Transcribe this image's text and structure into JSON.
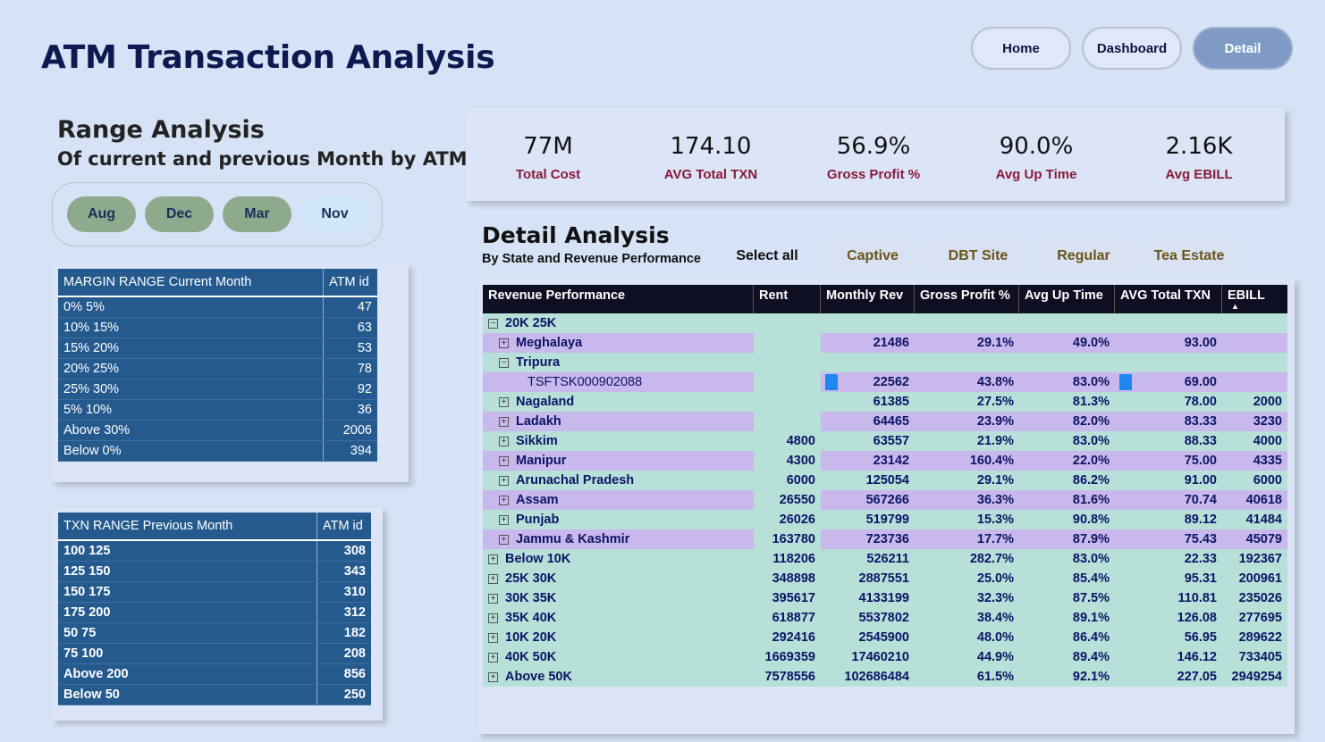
{
  "app_title": "ATM Transaction Analysis",
  "nav": {
    "home": "Home",
    "dashboard": "Dashboard",
    "detail": "Detail"
  },
  "range": {
    "title": "Range Analysis",
    "subtitle": "Of current and previous Month by ATM ID"
  },
  "months": [
    "Aug",
    "Dec",
    "Mar",
    "Nov"
  ],
  "margin_table": {
    "header": [
      "MARGIN RANGE Current Month",
      "ATM id"
    ],
    "rows": [
      [
        "0% 5%",
        "47"
      ],
      [
        "10% 15%",
        "63"
      ],
      [
        "15% 20%",
        "53"
      ],
      [
        "20% 25%",
        "78"
      ],
      [
        "25% 30%",
        "92"
      ],
      [
        "5% 10%",
        "36"
      ],
      [
        "Above 30%",
        "2006"
      ],
      [
        "Below 0%",
        "394"
      ]
    ]
  },
  "txn_table": {
    "header": [
      "TXN RANGE Previous Month",
      "ATM id"
    ],
    "rows": [
      [
        "100 125",
        "308"
      ],
      [
        "125 150",
        "343"
      ],
      [
        "150 175",
        "310"
      ],
      [
        "175 200",
        "312"
      ],
      [
        "50 75",
        "182"
      ],
      [
        "75 100",
        "208"
      ],
      [
        "Above 200",
        "856"
      ],
      [
        "Below 50",
        "250"
      ]
    ]
  },
  "kpis": [
    {
      "value": "77M",
      "label": "Total Cost"
    },
    {
      "value": "174.10",
      "label": "AVG Total TXN"
    },
    {
      "value": "56.9%",
      "label": "Gross Profit %"
    },
    {
      "value": "90.0%",
      "label": "Avg Up Time"
    },
    {
      "value": "2.16K",
      "label": "Avg EBILL"
    }
  ],
  "detail": {
    "title": "Detail Analysis",
    "subtitle": "By State and Revenue Performance",
    "select_all": "Select all",
    "segments": [
      "Captive",
      "DBT Site",
      "Regular",
      "Tea Estate"
    ],
    "headers": [
      "Revenue Performance",
      "Rent",
      "Monthly Rev",
      "Gross Profit %",
      "Avg Up Time",
      "AVG Total TXN",
      "EBILL"
    ],
    "sort_indicator": "▲",
    "rows": [
      {
        "level": 0,
        "toggle": "⊟",
        "label": "20K 25K",
        "vals": [
          "",
          "",
          "",
          "",
          "",
          ""
        ]
      },
      {
        "level": 1,
        "toggle": "⊞",
        "label": "Meghalaya",
        "vals": [
          "",
          "21486",
          "29.1%",
          "49.0%",
          "93.00",
          ""
        ]
      },
      {
        "level": 1,
        "toggle": "⊟",
        "label": "Tripura",
        "vals": [
          "",
          "",
          "",
          "",
          "",
          ""
        ]
      },
      {
        "level": 2,
        "toggle": "",
        "label": "TSFTSK000902088",
        "vals": [
          "",
          "22562",
          "43.8%",
          "83.0%",
          "69.00",
          ""
        ]
      },
      {
        "level": 1,
        "toggle": "⊞",
        "label": "Nagaland",
        "vals": [
          "",
          "61385",
          "27.5%",
          "81.3%",
          "78.00",
          "2000"
        ]
      },
      {
        "level": 1,
        "toggle": "⊞",
        "label": "Ladakh",
        "vals": [
          "",
          "64465",
          "23.9%",
          "82.0%",
          "83.33",
          "3230"
        ]
      },
      {
        "level": 1,
        "toggle": "⊞",
        "label": "Sikkim",
        "vals": [
          "4800",
          "63557",
          "21.9%",
          "83.0%",
          "88.33",
          "4000"
        ]
      },
      {
        "level": 1,
        "toggle": "⊞",
        "label": "Manipur",
        "vals": [
          "4300",
          "23142",
          "160.4%",
          "22.0%",
          "75.00",
          "4335"
        ]
      },
      {
        "level": 1,
        "toggle": "⊞",
        "label": "Arunachal Pradesh",
        "vals": [
          "6000",
          "125054",
          "29.1%",
          "86.2%",
          "91.00",
          "6000"
        ]
      },
      {
        "level": 1,
        "toggle": "⊞",
        "label": "Assam",
        "vals": [
          "26550",
          "567266",
          "36.3%",
          "81.6%",
          "70.74",
          "40618"
        ]
      },
      {
        "level": 1,
        "toggle": "⊞",
        "label": "Punjab",
        "vals": [
          "26026",
          "519799",
          "15.3%",
          "90.8%",
          "89.12",
          "41484"
        ]
      },
      {
        "level": 1,
        "toggle": "⊞",
        "label": "Jammu & Kashmir",
        "vals": [
          "163780",
          "723736",
          "17.7%",
          "87.9%",
          "75.43",
          "45079"
        ]
      },
      {
        "level": 0,
        "toggle": "⊞",
        "label": "Below 10K",
        "vals": [
          "118206",
          "526211",
          "282.7%",
          "83.0%",
          "22.33",
          "192367"
        ]
      },
      {
        "level": 0,
        "toggle": "⊞",
        "label": "25K 30K",
        "vals": [
          "348898",
          "2887551",
          "25.0%",
          "85.4%",
          "95.31",
          "200961"
        ]
      },
      {
        "level": 0,
        "toggle": "⊞",
        "label": "30K 35K",
        "vals": [
          "395617",
          "4133199",
          "32.3%",
          "87.5%",
          "110.81",
          "235026"
        ]
      },
      {
        "level": 0,
        "toggle": "⊞",
        "label": "35K 40K",
        "vals": [
          "618877",
          "5537802",
          "38.4%",
          "89.1%",
          "126.08",
          "277695"
        ]
      },
      {
        "level": 0,
        "toggle": "⊞",
        "label": "10K 20K",
        "vals": [
          "292416",
          "2545900",
          "48.0%",
          "86.4%",
          "56.95",
          "289622"
        ]
      },
      {
        "level": 0,
        "toggle": "⊞",
        "label": "40K 50K",
        "vals": [
          "1669359",
          "17460210",
          "44.9%",
          "89.4%",
          "146.12",
          "733405"
        ]
      },
      {
        "level": 0,
        "toggle": "⊞",
        "label": "Above 50K",
        "vals": [
          "7578556",
          "102686484",
          "61.5%",
          "92.1%",
          "227.05",
          "2949254"
        ]
      }
    ]
  },
  "colors": {
    "background": "#d6e2f6",
    "table_blue": "#255a8f",
    "row_teal": "#b6e0d8",
    "row_lavender": "#c8b8ec",
    "kpi_label": "#8a1a3a",
    "databar": "#1e88f0"
  }
}
